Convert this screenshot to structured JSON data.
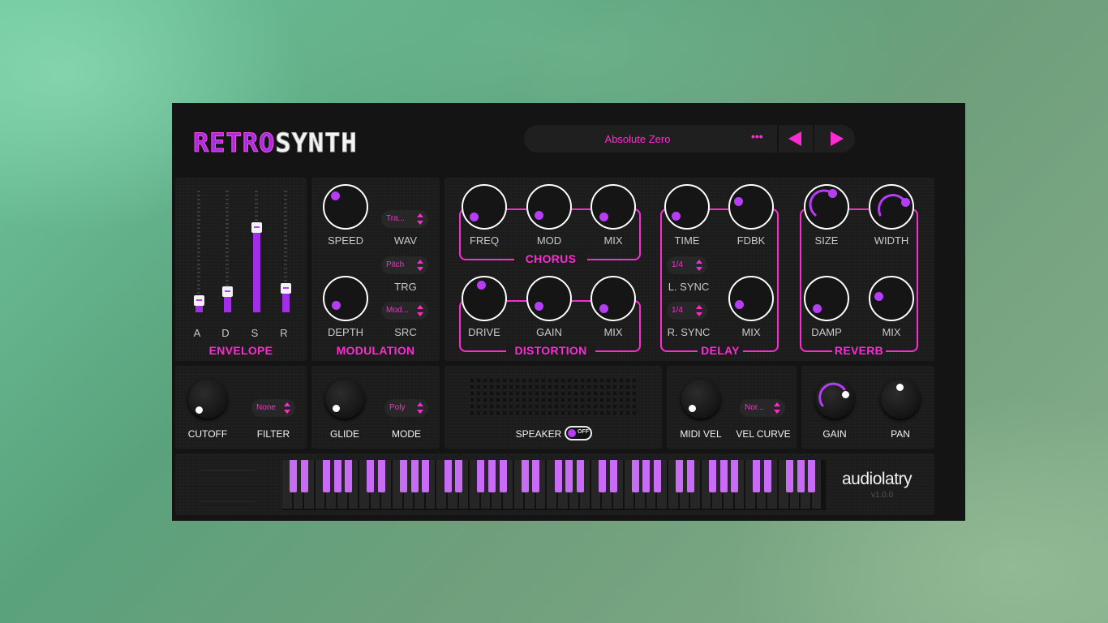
{
  "header": {
    "logo_part1": "RETRO",
    "logo_part2": "SYNTH",
    "preset_name": "Absolute Zero",
    "menu_glyph": "•••"
  },
  "envelope": {
    "title": "ENVELOPE",
    "sliders": [
      {
        "label": "A",
        "value": 0.1
      },
      {
        "label": "D",
        "value": 0.17
      },
      {
        "label": "S",
        "value": 0.7
      },
      {
        "label": "R",
        "value": 0.2
      }
    ]
  },
  "modulation": {
    "title": "MODULATION",
    "speed_label": "SPEED",
    "depth_label": "DEPTH",
    "wav_label": "WAV",
    "trg_label": "TRG",
    "src_label": "SRC",
    "wav_value": "Tra...",
    "trg_value": "Pitch",
    "src_value": "Mod..."
  },
  "chorus": {
    "title": "CHORUS",
    "freq_label": "FREQ",
    "mod_label": "MOD",
    "mix_label": "MIX"
  },
  "distortion": {
    "title": "DISTORTION",
    "drive_label": "DRIVE",
    "gain_label": "GAIN",
    "mix_label": "MIX"
  },
  "delay": {
    "title": "DELAY",
    "time_label": "TIME",
    "fdbk_label": "FDBK",
    "lsync_label": "L. SYNC",
    "rsync_label": "R. SYNC",
    "lsync_value": "1/4",
    "rsync_value": "1/4",
    "mix_label": "MIX"
  },
  "reverb": {
    "title": "REVERB",
    "size_label": "SIZE",
    "width_label": "WIDTH",
    "damp_label": "DAMP",
    "mix_label": "MIX"
  },
  "bottom": {
    "cutoff_label": "CUTOFF",
    "filter_label": "FILTER",
    "filter_value": "None",
    "glide_label": "GLIDE",
    "mode_label": "MODE",
    "mode_value": "Poly",
    "speaker_label": "SPEAKER",
    "speaker_state": "OFF",
    "midivel_label": "MIDI VEL",
    "velcurve_label": "VEL CURVE",
    "velcurve_value": "Nor...",
    "gain_label": "GAIN",
    "pan_label": "PAN"
  },
  "brand": {
    "name": "audiolatry",
    "version": "v1.0.0"
  },
  "colors": {
    "accent": "#ff2bd2",
    "purple": "#b63df5",
    "panel": "#1c1c1c",
    "key_black": "#c86cf6"
  },
  "icons": [
    "more-icon",
    "arrow-left-icon",
    "arrow-right-icon",
    "chevron-updown-icon"
  ]
}
